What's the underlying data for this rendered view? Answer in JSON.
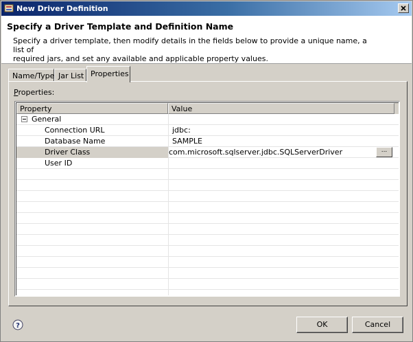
{
  "window": {
    "title": "New Driver Definition",
    "close_glyph": "✕",
    "accent": "#0a246a"
  },
  "banner": {
    "title": "Specify a Driver Template and Definition Name",
    "description_line1": "Specify a driver template, then modify details in the fields below to provide a unique name, a list of",
    "description_line2": "required jars, and set any available and applicable property values."
  },
  "tabs": [
    {
      "label": "Name/Type",
      "selected": false
    },
    {
      "label": "Jar List",
      "selected": false
    },
    {
      "label": "Properties",
      "selected": true
    }
  ],
  "properties_panel": {
    "label_first": "P",
    "label_rest": "roperties:",
    "columns": [
      "Property",
      "Value"
    ],
    "group": {
      "label": "General",
      "expanded": true
    },
    "rows": [
      {
        "property": "Connection URL",
        "value": "jdbc:"
      },
      {
        "property": "Database Name",
        "value": "SAMPLE"
      },
      {
        "property": "Driver Class",
        "value": "com.microsoft.sqlserver.jdbc.SQLServerDriver",
        "selected": true
      },
      {
        "property": "User ID",
        "value": ""
      }
    ],
    "browse_label": "..."
  },
  "footer": {
    "help_icon": "help-icon",
    "ok_label": "OK",
    "cancel_label": "Cancel"
  }
}
